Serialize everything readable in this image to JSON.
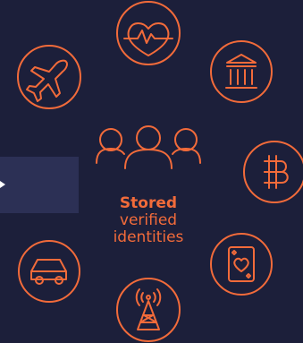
{
  "caption": {
    "title": "Stored",
    "line2": "verified",
    "line3": "identities"
  },
  "colors": {
    "background": "#1c1f3a",
    "accent": "#f26b3a",
    "panel": "#2c3055"
  },
  "icons": [
    "heart-pulse-icon",
    "bank-icon",
    "bitcoin-icon",
    "playing-card-icon",
    "cell-tower-icon",
    "car-icon",
    "airplane-icon",
    "people-group-icon"
  ]
}
